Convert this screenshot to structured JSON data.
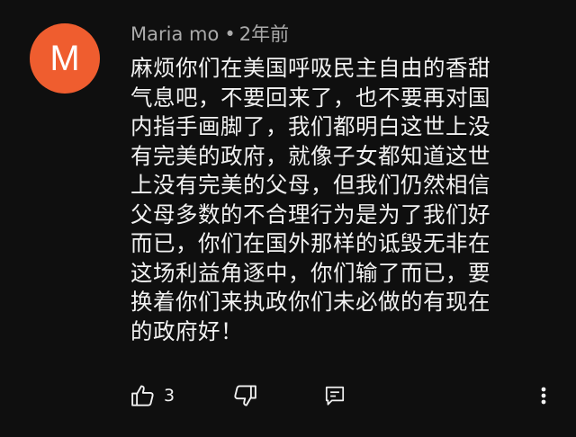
{
  "comment": {
    "avatar_letter": "M",
    "avatar_color": "#ef5d2f",
    "author": "Maria mo",
    "separator": "•",
    "timestamp": "2年前",
    "text": "麻烦你们在美国呼吸民主自由的香甜\n气息吧，不要回来了，也不要再对国\n内指手画脚了，我们都明白这世上没\n有完美的政府，就像子女都知道这世\n上没有完美的父母，但我们仍然相信\n父母多数的不合理行为是为了我们好\n而已，你们在国外那样的诋毁无非在\n这场利益角逐中，你们输了而已，要\n换着你们来执政你们未必做的有现在\n的政府好！",
    "like_count": "3"
  },
  "icons": {
    "like": "thumb-up-icon",
    "dislike": "thumb-down-icon",
    "reply": "reply-comment-icon",
    "more": "more-vertical-icon"
  }
}
